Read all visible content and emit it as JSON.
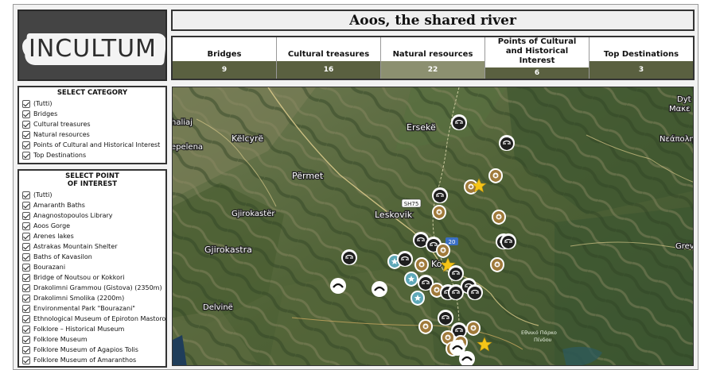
{
  "app": {
    "logo_text": "INCULTUM",
    "title": "Aoos, the shared river"
  },
  "stats": [
    {
      "label": "Bridges",
      "value": "9"
    },
    {
      "label": "Cultural treasures",
      "value": "16"
    },
    {
      "label": "Natural resources",
      "value": "22"
    },
    {
      "label": "Points of Cultural and Historical Interest",
      "value": "6"
    },
    {
      "label": "Top Destinations",
      "value": "3"
    }
  ],
  "category_panel": {
    "title": "SELECT CATEGORY",
    "items": [
      "(Tutti)",
      "Bridges",
      "Cultural treasures",
      "Natural resources",
      "Points of Cultural and Historical Interest",
      "Top Destinations"
    ]
  },
  "poi_panel": {
    "title_line1": "SELECT POINT",
    "title_line2": "OF INTEREST",
    "items": [
      "(Tutti)",
      "Amaranth Baths",
      "Anagnostopoulos Library",
      "Aoos Gorge",
      "Arenes lakes",
      "Astrakas Mountain Shelter",
      "Baths of Kavasilon",
      "Bourazani",
      "Bridge of Noutsou or Kokkori",
      "Drakolimni Grammou (Gistova) (2350m)",
      "Drakolimni Smolika (2200m)",
      "Environmental Park \"Bourazani\"",
      "Ethnological Museum of Epiroton Mastoron",
      "Folklore – Historical Museum",
      "Folklore Museum",
      "Folklore Museum of Agapios Tolis",
      "Folklore Museum of Amaranthos"
    ]
  },
  "map": {
    "labels": {
      "erseke": "Ersekë",
      "kelcyre": "Këlcyrë",
      "permet": "Përmet",
      "leskovik": "Leskovik",
      "gjirokaster": "Gjirokastër",
      "gjirokastra": "Gjirokastra",
      "delvine": "Delvinë",
      "tepelena": "epelena",
      "haliaj": "haliaj",
      "neapoli": "Νεάπολη",
      "greve": "Greve",
      "dyt": "Dyt",
      "make": "Μακε",
      "konitsa": "Ko",
      "sh75": "SH75",
      "r20": "20",
      "park": "Εθνικό Πάρκο",
      "pindou": "Πίνδου"
    }
  },
  "colors": {
    "stat_bar": "#5a6040",
    "stat_bar_active": "#8c9070",
    "pin_black": "#1e1e1e",
    "pin_gold": "#a07a3a",
    "pin_teal": "#5fa8b8",
    "star": "#f5c518"
  }
}
